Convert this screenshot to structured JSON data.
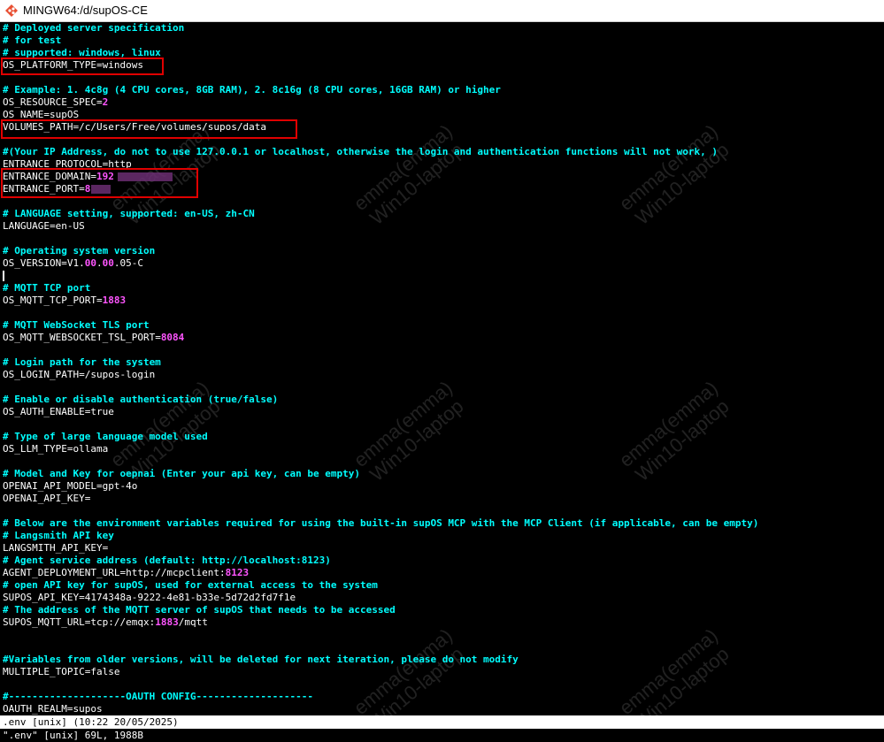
{
  "window": {
    "title": "MINGW64:/d/supOS-CE"
  },
  "status": {
    "line1": ".env [unix] (10:22 20/05/2025)",
    "line2": "\".env\" [unix] 69L, 1988B"
  },
  "watermark": {
    "line1": "emma(emma)",
    "line2": "Win10-laptop"
  },
  "env": {
    "c1": "# Deployed server specification",
    "c2": "# for test",
    "c3": "# supported: windows, linux",
    "os_platform_type": {
      "key": "OS_PLATFORM_TYPE",
      "value": "windows"
    },
    "c4": "# Example: 1. 4c8g (4 CPU cores, 8GB RAM), 2. 8c16g (8 CPU cores, 16GB RAM) or higher",
    "os_resource_spec": {
      "key": "OS_RESOURCE_SPEC",
      "value": "2"
    },
    "os_name": {
      "key": "OS_NAME",
      "value": "supOS"
    },
    "volumes_path": {
      "key": "VOLUMES_PATH",
      "value": "/c/Users/Free/volumes/supos/data"
    },
    "c5": "#(Your IP Address, do not to use 127.0.0.1 or localhost, otherwise the login and authentication functions will not work, )",
    "entrance_protocol": {
      "key": "ENTRANCE_PROTOCOL",
      "value": "http"
    },
    "entrance_domain": {
      "key": "ENTRANCE_DOMAIN",
      "value": "192"
    },
    "entrance_port": {
      "key": "ENTRANCE_PORT",
      "value": "8"
    },
    "c6": "# LANGUAGE setting, supported: en-US, zh-CN",
    "language": {
      "key": "LANGUAGE",
      "value": "en-US"
    },
    "c7": "# Operating system version",
    "os_version": {
      "key": "OS_VERSION",
      "v1": "V1.",
      "v2": "00",
      "v3": ".",
      "v4": "00",
      "v5": ".05-C"
    },
    "c8": "# MQTT TCP port",
    "os_mqtt_tcp_port": {
      "key": "OS_MQTT_TCP_PORT",
      "value": "1883"
    },
    "c9": "# MQTT WebSocket TLS port",
    "os_mqtt_websocket_tsl_port": {
      "key": "OS_MQTT_WEBSOCKET_TSL_PORT",
      "value": "8084"
    },
    "c10": "# Login path for the system",
    "os_login_path": {
      "key": "OS_LOGIN_PATH",
      "value": "/supos-login"
    },
    "c11": "# Enable or disable authentication (true/false)",
    "os_auth_enable": {
      "key": "OS_AUTH_ENABLE",
      "value": "true"
    },
    "c12": "# Type of large language model used",
    "os_llm_type": {
      "key": "OS_LLM_TYPE",
      "value": "ollama"
    },
    "c13": "# Model and Key for oepnai (Enter your api key, can be empty)",
    "openai_api_model": {
      "key": "OPENAI_API_MODEL",
      "value": "gpt-4o"
    },
    "openai_api_key": {
      "key": "OPENAI_API_KEY",
      "value": ""
    },
    "c14": "# Below are the environment variables required for using the built-in supOS MCP with the MCP Client (if applicable, can be empty)",
    "c15": "# Langsmith API key",
    "langsmith_api_key": {
      "key": "LANGSMITH_API_KEY",
      "value": ""
    },
    "c16": "# Agent service address (default: http://localhost:8123)",
    "agent_deployment_url": {
      "key": "AGENT_DEPLOYMENT_URL",
      "v1": "http://mcpclient:",
      "v2": "8123"
    },
    "c17": "# open API key for supOS, used for external access to the system",
    "supos_api_key": {
      "key": "SUPOS_API_KEY",
      "value": "4174348a-9222-4e81-b33e-5d72d2fd7f1e"
    },
    "c18": "# The address of the MQTT server of supOS that needs to be accessed",
    "supos_mqtt_url": {
      "key": "SUPOS_MQTT_URL",
      "v1": "tcp://emqx:",
      "v2": "1883",
      "v3": "/mqtt"
    },
    "c19": "#Variables from older versions, will be deleted for next iteration, please do not modify",
    "multiple_topic": {
      "key": "MULTIPLE_TOPIC",
      "value": "false"
    },
    "c20": "#--------------------OAUTH CONFIG--------------------",
    "oauth_realm": {
      "key": "OAUTH_REALM",
      "value": "supos"
    }
  }
}
